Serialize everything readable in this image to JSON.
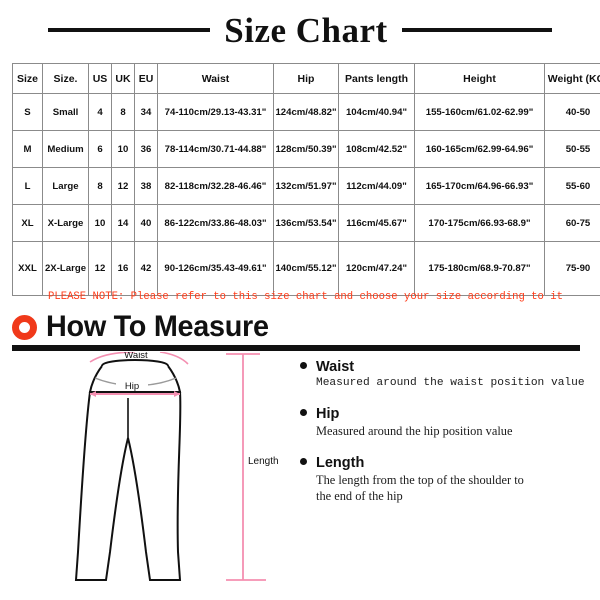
{
  "title": {
    "text": "Size Chart",
    "rule_color": "#111111"
  },
  "table": {
    "headers": [
      "Size",
      "Size.",
      "US",
      "UK",
      "EU",
      "Waist",
      "Hip",
      "Pants length",
      "Height",
      "Weight (KG)"
    ],
    "rows": [
      {
        "size": "S",
        "size_word": "Small",
        "us": "4",
        "uk": "8",
        "eu": "34",
        "waist": "74-110cm/29.13-43.31\"",
        "hip": "124cm/48.82\"",
        "pants_length": "104cm/40.94\"",
        "height": "155-160cm/61.02-62.99\"",
        "weight": "40-50"
      },
      {
        "size": "M",
        "size_word": "Medium",
        "us": "6",
        "uk": "10",
        "eu": "36",
        "waist": "78-114cm/30.71-44.88\"",
        "hip": "128cm/50.39\"",
        "pants_length": "108cm/42.52\"",
        "height": "160-165cm/62.99-64.96\"",
        "weight": "50-55"
      },
      {
        "size": "L",
        "size_word": "Large",
        "us": "8",
        "uk": "12",
        "eu": "38",
        "waist": "82-118cm/32.28-46.46\"",
        "hip": "132cm/51.97\"",
        "pants_length": "112cm/44.09\"",
        "height": "165-170cm/64.96-66.93\"",
        "weight": "55-60"
      },
      {
        "size": "XL",
        "size_word": "X-Large",
        "us": "10",
        "uk": "14",
        "eu": "40",
        "waist": "86-122cm/33.86-48.03\"",
        "hip": "136cm/53.54\"",
        "pants_length": "116cm/45.67\"",
        "height": "170-175cm/66.93-68.9\"",
        "weight": "60-75"
      },
      {
        "size": "XXL",
        "size_word": "2X-Large",
        "us": "12",
        "uk": "16",
        "eu": "42",
        "waist": "90-126cm/35.43-49.61\"",
        "hip": "140cm/55.12\"",
        "pants_length": "120cm/47.24\"",
        "height": "175-180cm/68.9-70.87\"",
        "weight": "75-90"
      }
    ]
  },
  "note": {
    "text": "PLEASE NOTE: Please refer to this size chart and choose your size according to it",
    "color": "#ff3b18"
  },
  "how_to_measure": {
    "heading": "How To Measure",
    "ring_color": "#f0391a",
    "items": [
      {
        "title": "Waist",
        "desc": "Measured around the waist position value"
      },
      {
        "title": "Hip",
        "desc": "Measured around the  hip position value"
      },
      {
        "title": "Length",
        "desc_line1": "The length from the top of the shoulder to",
        "desc_line2": "the end of the hip"
      }
    ]
  },
  "diagram": {
    "label_waist": "Waist",
    "label_hip": "Hip",
    "label_length": "Length",
    "measure_color": "#f48fb1"
  }
}
